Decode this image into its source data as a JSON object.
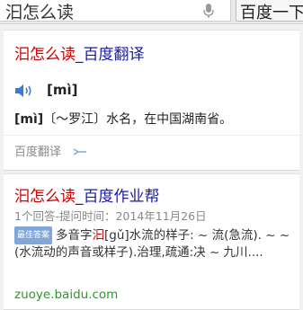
{
  "search": {
    "query": "汩怎么读",
    "button_label": "百度一下"
  },
  "results": [
    {
      "title_highlight": "汩怎么读",
      "title_rest": "_百度翻译",
      "pinyin": "[mì]",
      "definition_pinyin": "[mì]",
      "definition_text": "〔～罗江〕水名，在中国湖南省。",
      "source_label": "百度翻译"
    },
    {
      "title_highlight": "汩怎么读",
      "title_rest": "_百度作业帮",
      "meta": "1个回答-提问时间：2014年11月26日",
      "badge": "最佳答案",
      "snippet_prefix": "多音字",
      "snippet_highlight": "汩",
      "snippet_rest": "[gǔ]水流的样子: ~ 流(急流). ~ ~ (水流动的声音或样子).治理,疏通:决 ~ 九川....",
      "url": "zuoye.baidu.com"
    }
  ],
  "colors": {
    "link_blue": "#1a1aa6",
    "highlight_red": "#cc0000",
    "url_green": "#2a9a2a"
  }
}
